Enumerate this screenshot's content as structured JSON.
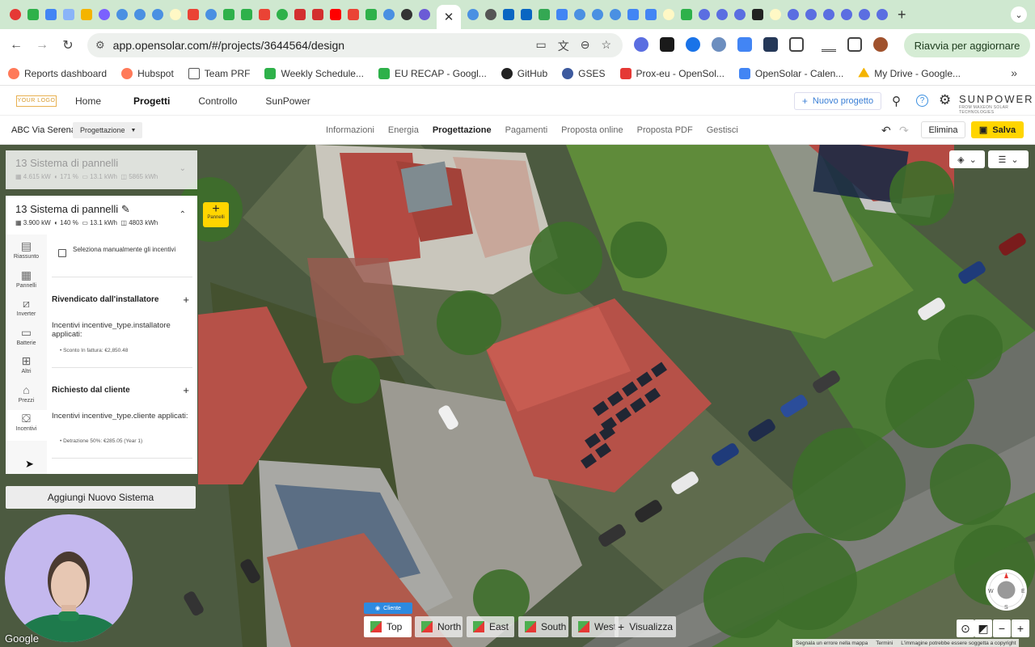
{
  "browser": {
    "url": "app.opensolar.com/#/projects/3644564/design",
    "relaunch_label": "Riavvia per aggiornare",
    "bookmarks": [
      "Reports dashboard",
      "Hubspot",
      "Team PRF",
      "Weekly Schedule...",
      "EU RECAP - Googl...",
      "GitHub",
      "GSES",
      "Prox-eu - OpenSol...",
      "OpenSolar - Calen...",
      "My Drive - Google..."
    ]
  },
  "appnav": {
    "logo": "YOUR LOGO",
    "links": [
      "Home",
      "Progetti",
      "Controllo",
      "SunPower"
    ],
    "new_project": "Nuovo progetto",
    "brand": "SUNPOWER",
    "brand_sub": "FROM MAXEON SOLAR TECHNOLOGIES"
  },
  "subbar": {
    "project_name": "ABC Via Serena",
    "phase": "Progettazione",
    "stages": [
      "Informazioni",
      "Energia",
      "Progettazione",
      "Pagamenti",
      "Proposta online",
      "Proposta PDF",
      "Gestisci"
    ],
    "delete_label": "Elimina",
    "save_label": "Salva"
  },
  "systems": [
    {
      "title": "13 Sistema di pannelli",
      "kw": "4.615",
      "kw_unit": "kW",
      "pct": "171",
      "pct_unit": "%",
      "kwh": "13.1",
      "kwh_unit": "kWh",
      "prod": "5865",
      "prod_unit": "kWh"
    },
    {
      "title": "13 Sistema di pannelli",
      "kw": "3.900",
      "kw_unit": "kW",
      "pct": "140",
      "pct_unit": "%",
      "kwh": "13.1",
      "kwh_unit": "kWh",
      "prod": "4803",
      "prod_unit": "kWh"
    }
  ],
  "sidetabs": [
    "Riassunto",
    "Pannelli",
    "Inverter",
    "Batterie",
    "Altri",
    "Prezzi",
    "Incentivi"
  ],
  "incentives": {
    "manual_select": "Seleziona manualmente gli incentivi",
    "installer_title": "Rivendicato dall'installatore",
    "installer_applied": "Incentivi incentive_type.installatore applicati:",
    "installer_item": "Sconto In fattura: €2,850.48",
    "client_title": "Richiesto dal cliente",
    "client_applied": "Incentivi incentive_type.cliente applicati:",
    "client_item": "Detrazione 50%: €285.05 (Year 1)"
  },
  "add_system": "Aggiungi Nuovo Sistema",
  "panels_button": "Pannelli",
  "view": {
    "client_chip": "Cliente",
    "buttons": [
      "Top",
      "North",
      "East",
      "South",
      "West"
    ],
    "visualize": "Visualizza"
  },
  "map": {
    "google": "Google",
    "attribution": [
      "Segnala un errore nella mappa",
      "Termini",
      "L'immagine potrebbe essere soggetta a copyright"
    ]
  },
  "colors": {
    "accent": "#ffd500",
    "link": "#3b7fd6"
  }
}
